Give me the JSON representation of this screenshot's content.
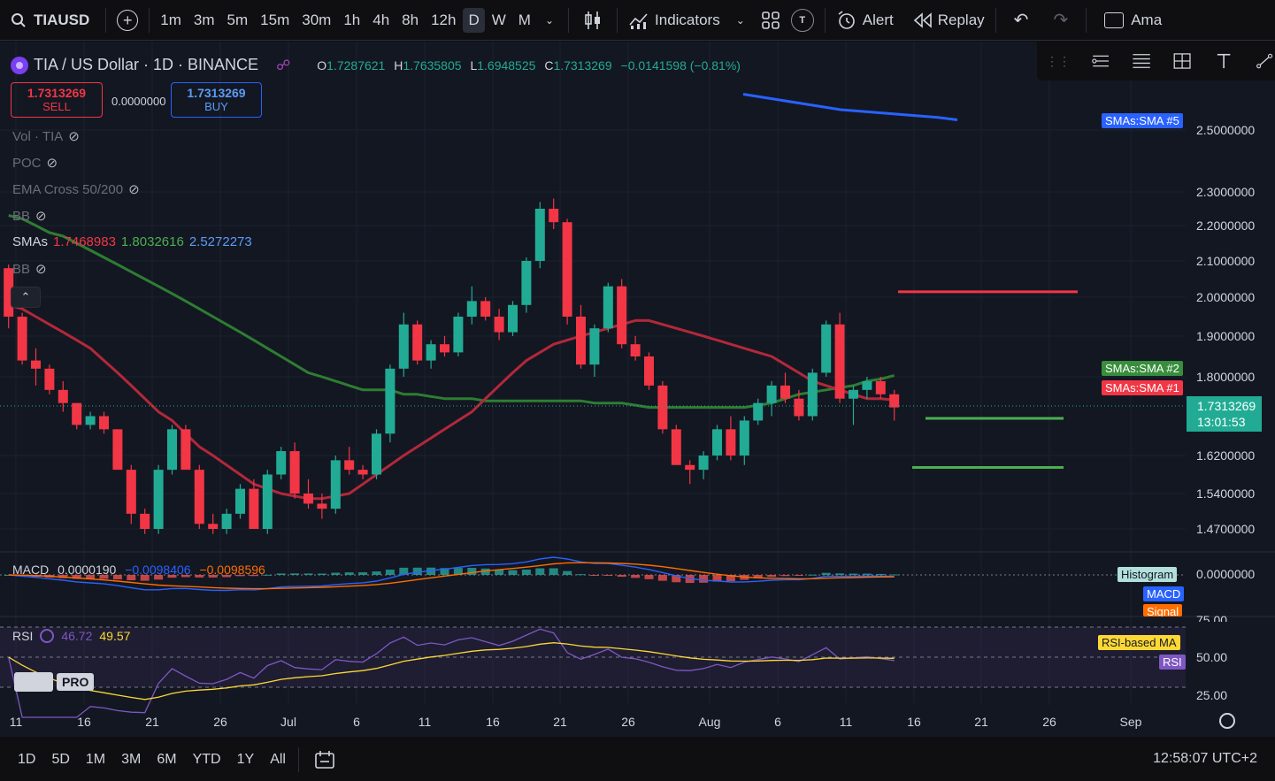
{
  "toolbar": {
    "symbol": "TIAUSD",
    "intervals": [
      "1m",
      "3m",
      "5m",
      "15m",
      "30m",
      "1h",
      "4h",
      "8h",
      "12h",
      "D",
      "W",
      "M"
    ],
    "active_interval": "D",
    "indicators_label": "Indicators",
    "t_badge": "T",
    "alert_label": "Alert",
    "replay_label": "Replay",
    "truncated_label": "Ama"
  },
  "legend": {
    "title": "TIA / US Dollar · 1D · BINANCE",
    "o_label": "O",
    "o": "1.7287621",
    "h_label": "H",
    "h": "1.7635805",
    "l_label": "L",
    "l": "1.6948525",
    "c_label": "C",
    "c": "1.7313269",
    "change": "−0.0141598 (−0.81%)"
  },
  "trade": {
    "sell_price": "1.7313269",
    "sell_label": "SELL",
    "spread": "0.0000000",
    "buy_price": "1.7313269",
    "buy_label": "BUY"
  },
  "indicators": [
    {
      "label": "Vol · TIA"
    },
    {
      "label": "POC"
    },
    {
      "label": "EMA Cross 50/200"
    },
    {
      "label": "BB"
    },
    {
      "label": "SMAs",
      "values": [
        "1.7468983",
        "1.8032616",
        "2.5272273"
      ]
    },
    {
      "label": "BB"
    }
  ],
  "macd": {
    "label": "MACD",
    "v1": "0.0000190",
    "v2": "−0.0098406",
    "v3": "−0.0098596"
  },
  "rsi": {
    "label": "RSI",
    "v1": "46.72",
    "v2": "49.57"
  },
  "tags": {
    "sma5": "SMAs:SMA #5",
    "sma2": "SMAs:SMA #2",
    "sma1": "SMAs:SMA #1",
    "histogram": "Histogram",
    "macd": "MACD",
    "signal": "Signal",
    "rsi_ma": "RSI-based MA",
    "rsi": "RSI"
  },
  "price_axis": [
    "2.5000000",
    "2.3000000",
    "2.2000000",
    "2.1000000",
    "2.0000000",
    "1.9000000",
    "1.8000000",
    "1.6200000",
    "1.5400000",
    "1.4700000"
  ],
  "current_price": {
    "price": "1.7313269",
    "countdown": "13:01:53"
  },
  "macd_axis": "0.0000000",
  "rsi_axis": [
    "75.00",
    "50.00",
    "25.00"
  ],
  "time_axis": [
    "11",
    "16",
    "21",
    "26",
    "Jul",
    "6",
    "11",
    "16",
    "21",
    "26",
    "Aug",
    "6",
    "11",
    "16",
    "21",
    "26",
    "Sep"
  ],
  "tv_logo": "PRO",
  "bottom": {
    "ranges": [
      "1D",
      "5D",
      "1M",
      "3M",
      "6M",
      "YTD",
      "1Y",
      "All"
    ],
    "clock": "12:58:07 UTC+2"
  },
  "colors": {
    "up": "#22ab94",
    "down": "#f23645",
    "sma1": "#b2283a",
    "sma2": "#2e7d32",
    "sma5": "#2962ff"
  },
  "chart_data": {
    "type": "candlestick",
    "candles": [
      [
        2.08,
        2.09,
        1.92,
        1.95
      ],
      [
        1.95,
        1.96,
        1.83,
        1.84
      ],
      [
        1.84,
        1.87,
        1.78,
        1.82
      ],
      [
        1.82,
        1.83,
        1.76,
        1.77
      ],
      [
        1.77,
        1.79,
        1.72,
        1.74
      ],
      [
        1.74,
        1.74,
        1.68,
        1.69
      ],
      [
        1.69,
        1.72,
        1.68,
        1.71
      ],
      [
        1.71,
        1.72,
        1.67,
        1.68
      ],
      [
        1.68,
        1.68,
        1.6,
        1.59
      ],
      [
        1.59,
        1.6,
        1.48,
        1.5
      ],
      [
        1.5,
        1.51,
        1.46,
        1.47
      ],
      [
        1.47,
        1.6,
        1.46,
        1.59
      ],
      [
        1.59,
        1.69,
        1.58,
        1.68
      ],
      [
        1.68,
        1.69,
        1.6,
        1.59
      ],
      [
        1.59,
        1.6,
        1.47,
        1.48
      ],
      [
        1.48,
        1.5,
        1.46,
        1.47
      ],
      [
        1.47,
        1.51,
        1.46,
        1.5
      ],
      [
        1.5,
        1.56,
        1.49,
        1.55
      ],
      [
        1.55,
        1.57,
        1.47,
        1.47
      ],
      [
        1.47,
        1.59,
        1.46,
        1.58
      ],
      [
        1.58,
        1.64,
        1.57,
        1.63
      ],
      [
        1.63,
        1.65,
        1.53,
        1.54
      ],
      [
        1.54,
        1.57,
        1.51,
        1.52
      ],
      [
        1.52,
        1.54,
        1.49,
        1.51
      ],
      [
        1.51,
        1.62,
        1.5,
        1.61
      ],
      [
        1.61,
        1.64,
        1.58,
        1.59
      ],
      [
        1.59,
        1.6,
        1.57,
        1.58
      ],
      [
        1.58,
        1.68,
        1.57,
        1.67
      ],
      [
        1.67,
        1.83,
        1.65,
        1.82
      ],
      [
        1.82,
        1.96,
        1.8,
        1.93
      ],
      [
        1.93,
        1.94,
        1.83,
        1.84
      ],
      [
        1.84,
        1.89,
        1.82,
        1.88
      ],
      [
        1.88,
        1.9,
        1.85,
        1.86
      ],
      [
        1.86,
        1.96,
        1.85,
        1.95
      ],
      [
        1.95,
        2.03,
        1.93,
        1.99
      ],
      [
        1.99,
        2.0,
        1.94,
        1.95
      ],
      [
        1.95,
        1.97,
        1.89,
        1.91
      ],
      [
        1.91,
        1.99,
        1.9,
        1.98
      ],
      [
        1.98,
        2.11,
        1.96,
        2.1
      ],
      [
        2.1,
        2.27,
        2.08,
        2.25
      ],
      [
        2.25,
        2.28,
        2.19,
        2.21
      ],
      [
        2.21,
        2.22,
        1.93,
        1.95
      ],
      [
        1.95,
        1.98,
        1.82,
        1.83
      ],
      [
        1.83,
        1.93,
        1.8,
        1.92
      ],
      [
        1.92,
        2.04,
        1.91,
        2.03
      ],
      [
        2.03,
        2.05,
        1.87,
        1.88
      ],
      [
        1.88,
        1.9,
        1.84,
        1.85
      ],
      [
        1.85,
        1.86,
        1.77,
        1.78
      ],
      [
        1.78,
        1.79,
        1.67,
        1.68
      ],
      [
        1.68,
        1.69,
        1.6,
        1.6
      ],
      [
        1.6,
        1.61,
        1.56,
        1.59
      ],
      [
        1.59,
        1.63,
        1.57,
        1.62
      ],
      [
        1.62,
        1.69,
        1.61,
        1.68
      ],
      [
        1.68,
        1.71,
        1.61,
        1.62
      ],
      [
        1.62,
        1.71,
        1.6,
        1.7
      ],
      [
        1.7,
        1.75,
        1.69,
        1.74
      ],
      [
        1.74,
        1.79,
        1.71,
        1.78
      ],
      [
        1.78,
        1.81,
        1.74,
        1.75
      ],
      [
        1.75,
        1.77,
        1.7,
        1.71
      ],
      [
        1.71,
        1.82,
        1.7,
        1.81
      ],
      [
        1.81,
        1.94,
        1.8,
        1.93
      ],
      [
        1.93,
        1.96,
        1.74,
        1.75
      ],
      [
        1.75,
        1.78,
        1.69,
        1.77
      ],
      [
        1.77,
        1.8,
        1.75,
        1.79
      ],
      [
        1.79,
        1.8,
        1.75,
        1.76
      ],
      [
        1.76,
        1.77,
        1.7,
        1.73
      ]
    ],
    "overlays": {
      "sma1": [
        1.98,
        1.97,
        1.95,
        1.93,
        1.91,
        1.89,
        1.87,
        1.84,
        1.81,
        1.78,
        1.75,
        1.72,
        1.7,
        1.67,
        1.64,
        1.62,
        1.6,
        1.58,
        1.56,
        1.55,
        1.54,
        1.535,
        1.53,
        1.53,
        1.535,
        1.54,
        1.56,
        1.58,
        1.6,
        1.62,
        1.64,
        1.66,
        1.68,
        1.7,
        1.72,
        1.75,
        1.78,
        1.81,
        1.84,
        1.86,
        1.88,
        1.89,
        1.9,
        1.91,
        1.92,
        1.93,
        1.94,
        1.94,
        1.93,
        1.92,
        1.91,
        1.9,
        1.89,
        1.88,
        1.87,
        1.86,
        1.85,
        1.83,
        1.81,
        1.79,
        1.78,
        1.77,
        1.76,
        1.75,
        1.75,
        1.747
      ],
      "sma2": [
        2.23,
        2.22,
        2.2,
        2.18,
        2.17,
        2.15,
        2.13,
        2.11,
        2.09,
        2.07,
        2.05,
        2.03,
        2.01,
        1.99,
        1.97,
        1.95,
        1.93,
        1.91,
        1.89,
        1.87,
        1.85,
        1.83,
        1.81,
        1.8,
        1.79,
        1.78,
        1.77,
        1.77,
        1.77,
        1.76,
        1.76,
        1.755,
        1.75,
        1.75,
        1.75,
        1.745,
        1.745,
        1.745,
        1.745,
        1.745,
        1.745,
        1.745,
        1.745,
        1.74,
        1.74,
        1.74,
        1.735,
        1.73,
        1.73,
        1.73,
        1.73,
        1.73,
        1.73,
        1.73,
        1.73,
        1.735,
        1.74,
        1.75,
        1.76,
        1.765,
        1.77,
        1.775,
        1.78,
        1.79,
        1.795,
        1.803
      ],
      "sma5": [
        2.61,
        2.6,
        2.59,
        2.58,
        2.57,
        2.56,
        2.555,
        2.55,
        2.545,
        2.54,
        2.535,
        2.527
      ]
    },
    "hlines": [
      {
        "price": 2.015,
        "color": "#f23645"
      },
      {
        "price": 1.705,
        "color": "#4caf50"
      },
      {
        "price": 1.595,
        "color": "#4caf50"
      }
    ]
  }
}
